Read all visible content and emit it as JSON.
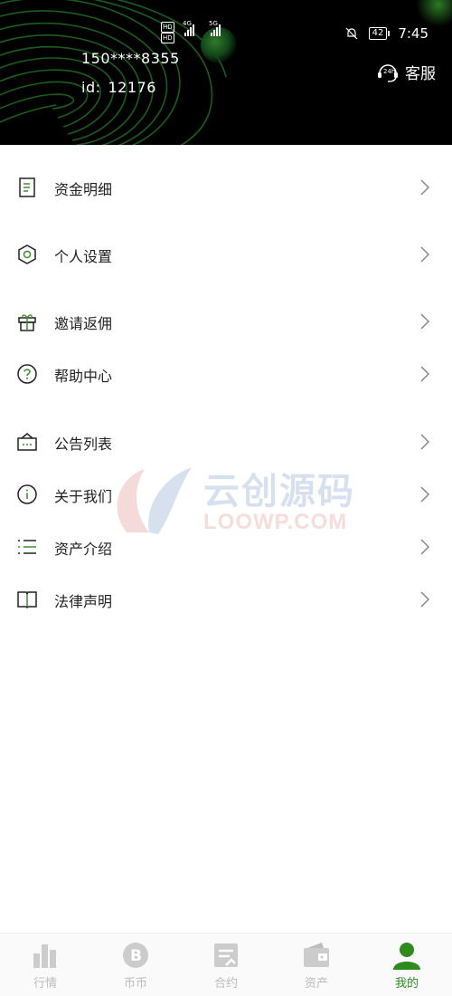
{
  "status_bar": {
    "network_left": "HD",
    "network_type_1": "4G",
    "network_type_2": "5G",
    "battery": "42",
    "time": "7:45"
  },
  "user": {
    "phone": "150****8355",
    "id_label": "id:",
    "id_value": "12176"
  },
  "service": {
    "icon": "24h-headset-icon",
    "label": "客服"
  },
  "menu": {
    "items": [
      {
        "label": "资金明细",
        "icon": "document-icon"
      },
      {
        "label": "个人设置",
        "icon": "hexagon-settings-icon"
      },
      {
        "label": "邀请返佣",
        "icon": "gift-icon"
      },
      {
        "label": "帮助中心",
        "icon": "help-circle-icon"
      },
      {
        "label": "公告列表",
        "icon": "announcement-icon"
      },
      {
        "label": "关于我们",
        "icon": "info-icon"
      },
      {
        "label": "资产介绍",
        "icon": "list-icon"
      },
      {
        "label": "法律声明",
        "icon": "book-icon"
      }
    ]
  },
  "watermark": {
    "title": "云创源码",
    "subtitle": "LOOWP.COM"
  },
  "tabbar": {
    "tabs": [
      {
        "label": "行情",
        "icon": "bar-chart-icon",
        "active": false
      },
      {
        "label": "币币",
        "icon": "bitcoin-icon",
        "active": false
      },
      {
        "label": "合约",
        "icon": "contract-icon",
        "active": false
      },
      {
        "label": "资产",
        "icon": "wallet-icon",
        "active": false
      },
      {
        "label": "我的",
        "icon": "user-icon",
        "active": true
      }
    ]
  },
  "colors": {
    "accent": "#2e8b1e",
    "header_bg": "#000000",
    "icon_green": "#3a8f2b",
    "inactive_tab": "#bbbbbb"
  }
}
